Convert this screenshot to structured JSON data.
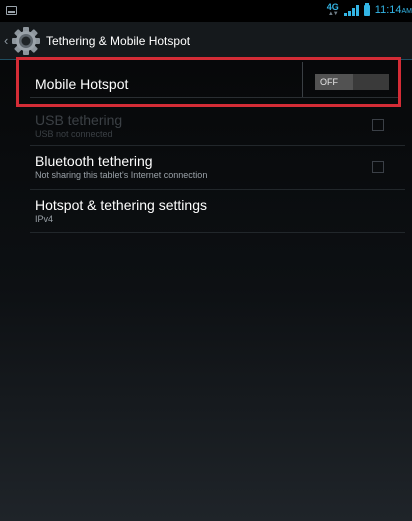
{
  "status_bar": {
    "screenshot_icon": "screenshot-icon",
    "network_label": "4G",
    "time": "11:14",
    "ampm": "AM"
  },
  "action_bar": {
    "back_icon": "caret-left",
    "app_icon": "settings-gear-icon",
    "title": "Tethering & Mobile Hotspot"
  },
  "hotspot": {
    "label": "Mobile Hotspot",
    "toggle_state": "OFF",
    "highlight_color": "#d42c36"
  },
  "items": [
    {
      "title": "USB tethering",
      "subtitle": "USB not connected",
      "enabled": false,
      "checked": false
    },
    {
      "title": "Bluetooth tethering",
      "subtitle": "Not sharing this tablet's Internet connection",
      "enabled": true,
      "checked": false
    },
    {
      "title": "Hotspot & tethering settings",
      "subtitle": "IPv4",
      "enabled": true
    }
  ],
  "colors": {
    "accent": "#33b5e5",
    "background": "#0d1013",
    "secondary_text": "#9ba2a8"
  }
}
